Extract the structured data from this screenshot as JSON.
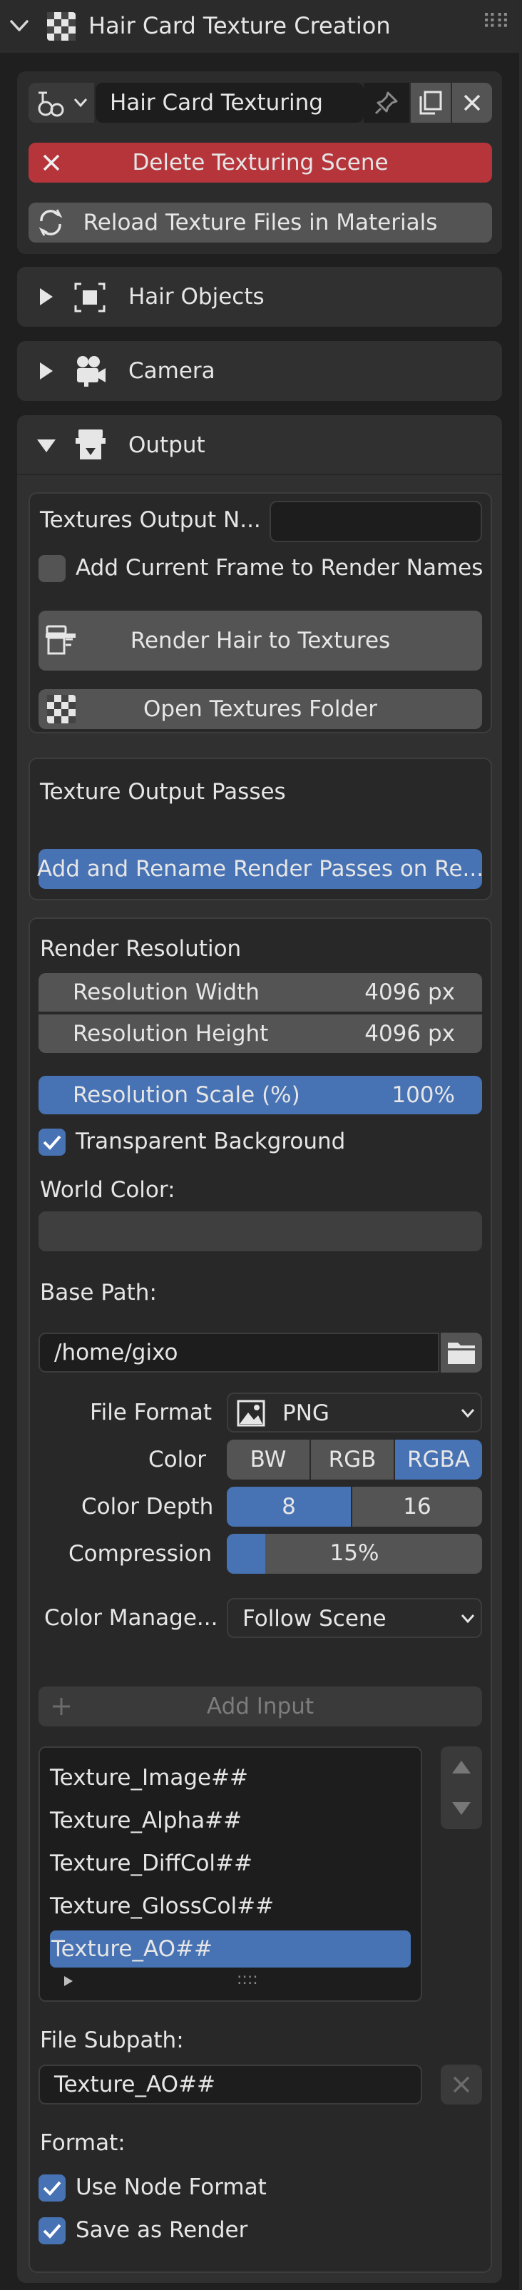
{
  "header": {
    "title": "Hair Card Texture Creation"
  },
  "top": {
    "scene_name": "Hair Card Texturing",
    "delete_label": "Delete Texturing Scene",
    "reload_label": "Reload Texture Files in Materials"
  },
  "sections": {
    "hair_objects": "Hair Objects",
    "camera": "Camera",
    "output": "Output"
  },
  "output": {
    "textures_output_label": "Textures Output N...",
    "textures_output_value": "",
    "add_frame_label": "Add Current Frame to Render Names",
    "render_label": "Render Hair to Textures",
    "open_folder_label": "Open Textures Folder"
  },
  "passes": {
    "title": "Texture Output Passes",
    "add_rename_label": "Add and Rename Render Passes on Re..."
  },
  "render": {
    "title": "Render Resolution",
    "width_label": "Resolution Width",
    "width_value": "4096 px",
    "height_label": "Resolution Height",
    "height_value": "4096 px",
    "scale_label": "Resolution Scale (%)",
    "scale_value": "100%",
    "transparent_label": "Transparent Background",
    "world_color_label": "World Color:",
    "base_path_label": "Base Path:",
    "base_path_value": "/home/gixo",
    "file_format_label": "File Format",
    "file_format_value": "PNG",
    "color_label": "Color",
    "color_options": [
      "BW",
      "RGB",
      "RGBA"
    ],
    "color_selected": "RGBA",
    "color_depth_label": "Color Depth",
    "color_depth_options": [
      "8",
      "16"
    ],
    "color_depth_selected": "8",
    "compression_label": "Compression",
    "compression_value": "15%",
    "compression_fraction": 0.15,
    "color_manage_label": "Color Manage...",
    "color_manage_value": "Follow Scene",
    "add_input_label": "Add Input",
    "inputs": [
      "Texture_Image##",
      "Texture_Alpha##",
      "Texture_DiffCol##",
      "Texture_GlossCol##",
      "Texture_AO##"
    ],
    "selected_input": "Texture_AO##",
    "file_subpath_label": "File Subpath:",
    "file_subpath_value": "Texture_AO##",
    "format_label": "Format:",
    "use_node_format_label": "Use Node Format",
    "save_as_render_label": "Save as Render"
  },
  "colors": {
    "accent": "#4772b3",
    "danger": "#b5353b",
    "background": "#1f1f1f",
    "panel": "#303030",
    "button": "#545454"
  }
}
